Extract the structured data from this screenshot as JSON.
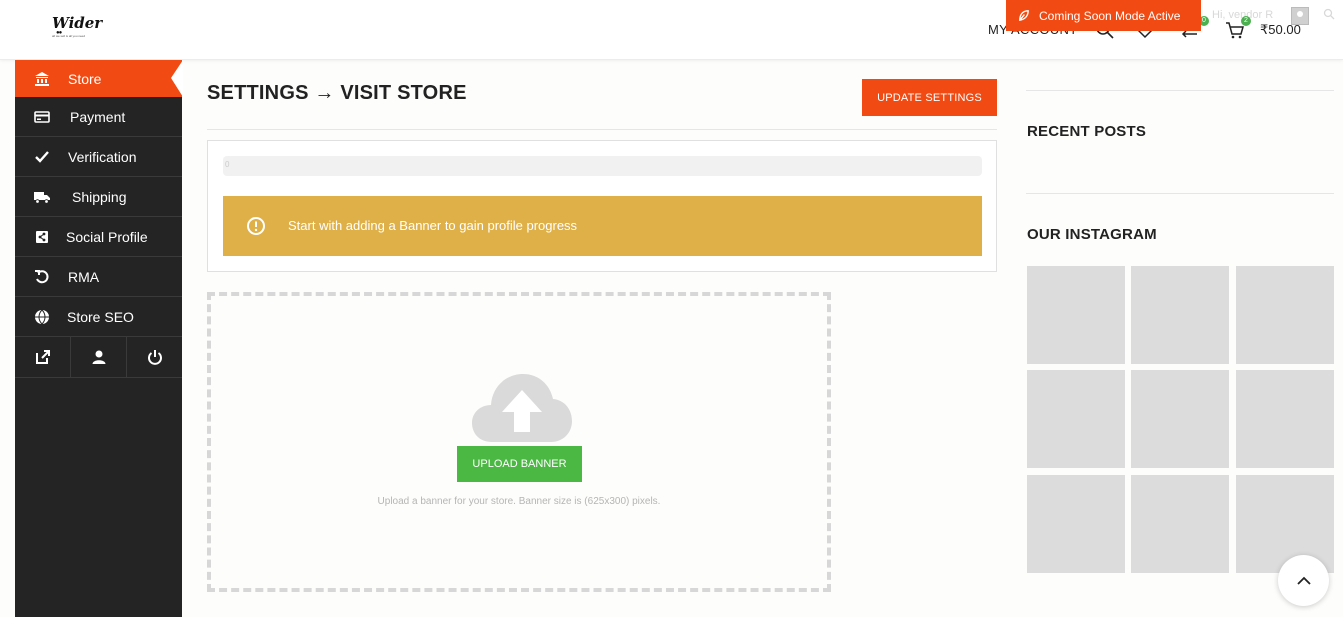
{
  "header": {
    "logo_text": "Wider",
    "logo_tagline": "all we sell is all you need",
    "coming_soon_label": "Coming Soon Mode Active",
    "faded_user": "Hi, vendor R",
    "my_account": "MY ACCOUNT",
    "compare_badge": "0",
    "cart_badge": "2",
    "cart_amount": "₹50.00"
  },
  "sidebar": {
    "items": [
      {
        "label": "Store",
        "icon": "bank-icon",
        "active": true
      },
      {
        "label": "Payment",
        "icon": "credit-card-icon",
        "active": false
      },
      {
        "label": "Verification",
        "icon": "checkmark-icon",
        "active": false
      },
      {
        "label": "Shipping",
        "icon": "truck-icon",
        "active": false
      },
      {
        "label": "Social Profile",
        "icon": "share-icon",
        "active": false
      },
      {
        "label": "RMA",
        "icon": "undo-icon",
        "active": false
      },
      {
        "label": "Store SEO",
        "icon": "globe-icon",
        "active": false
      }
    ],
    "tools": [
      "external-link-icon",
      "user-icon",
      "power-icon"
    ]
  },
  "main": {
    "title": "SETTINGS → VISIT STORE",
    "update_button": "UPDATE SETTINGS",
    "progress": {
      "value_percent": 0,
      "label": "0"
    },
    "alert_text": "Start with adding a Banner to gain profile progress",
    "upload_button": "UPLOAD BANNER",
    "upload_hint": "Upload a banner for your store. Banner size is (625x300) pixels."
  },
  "widgets": {
    "recent_posts_title": "RECENT POSTS",
    "instagram_title": "OUR INSTAGRAM",
    "instagram_tiles": 9
  },
  "colors": {
    "accent": "#f14a12",
    "sidebar_bg": "#242424",
    "alert_bg": "#dfb048",
    "upload_green": "#4cb844"
  }
}
